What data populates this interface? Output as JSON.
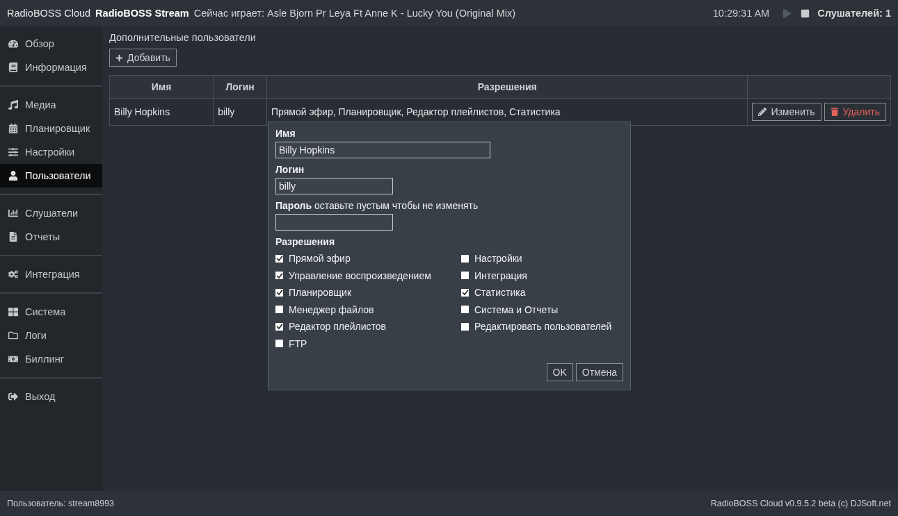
{
  "top_bar": {
    "brand": "RadioBOSS Cloud",
    "station": "RadioBOSS Stream",
    "now_playing": "Сейчас играет: Asle Bjorn Pr Leya Ft Anne K - Lucky You (Original Mix)",
    "time": "10:29:31 AM",
    "listeners": "Слушателей: 1"
  },
  "sidebar": {
    "groups": [
      {
        "items": [
          {
            "label": "Обзор",
            "selected": false
          },
          {
            "label": "Информация",
            "selected": false
          }
        ]
      },
      {
        "items": [
          {
            "label": "Медиа",
            "selected": false
          },
          {
            "label": "Планировщик",
            "selected": false
          },
          {
            "label": "Настройки",
            "selected": false
          },
          {
            "label": "Пользователи",
            "selected": true
          }
        ]
      },
      {
        "items": [
          {
            "label": "Слушатели",
            "selected": false
          },
          {
            "label": "Отчеты",
            "selected": false
          }
        ]
      },
      {
        "items": [
          {
            "label": "Интеграция",
            "selected": false
          }
        ]
      },
      {
        "items": [
          {
            "label": "Система",
            "selected": false
          },
          {
            "label": "Логи",
            "selected": false
          },
          {
            "label": "Биллинг",
            "selected": false
          }
        ]
      },
      {
        "items": [
          {
            "label": "Выход",
            "selected": false
          }
        ]
      }
    ]
  },
  "page_title": "Дополнительные пользователи",
  "add_button": "Добавить",
  "table": {
    "columns": [
      "Имя",
      "Логин",
      "Разрешения"
    ],
    "rows": [
      {
        "name": "Billy Hopkins",
        "login": "billy",
        "permissions": "Прямой эфир, Планировщик, Редактор плейлистов, Статистика",
        "edit": "Изменить",
        "delete": "Удалить"
      }
    ]
  },
  "dialog": {
    "name_label": "Имя",
    "name_value": "Billy Hopkins",
    "login_label": "Логин",
    "login_value": "billy",
    "password_label": "Пароль",
    "password_hint": "оставьте пустым чтобы не изменять",
    "permissions_label": "Разрешения",
    "permission_columns": [
      [
        {
          "label": "Прямой эфир",
          "checked": true
        },
        {
          "label": "Управление воспроизведением",
          "checked": true
        },
        {
          "label": "Планировщик",
          "checked": true
        },
        {
          "label": "Менеджер файлов",
          "checked": false
        },
        {
          "label": "Редактор плейлистов",
          "checked": true
        },
        {
          "label": "FTP",
          "checked": false
        }
      ],
      [
        {
          "label": "Настройки",
          "checked": false
        },
        {
          "label": "Интеграция",
          "checked": false
        },
        {
          "label": "Статистика",
          "checked": true
        },
        {
          "label": "Система и Отчеты",
          "checked": false
        },
        {
          "label": "Редактировать пользователей",
          "checked": false
        }
      ]
    ],
    "ok": "OK",
    "cancel": "Отмена"
  },
  "status_bar": {
    "user": "Пользователь: stream8993",
    "version": "RadioBOSS Cloud v0.9.5.2 beta (c) DJSoft.net"
  }
}
